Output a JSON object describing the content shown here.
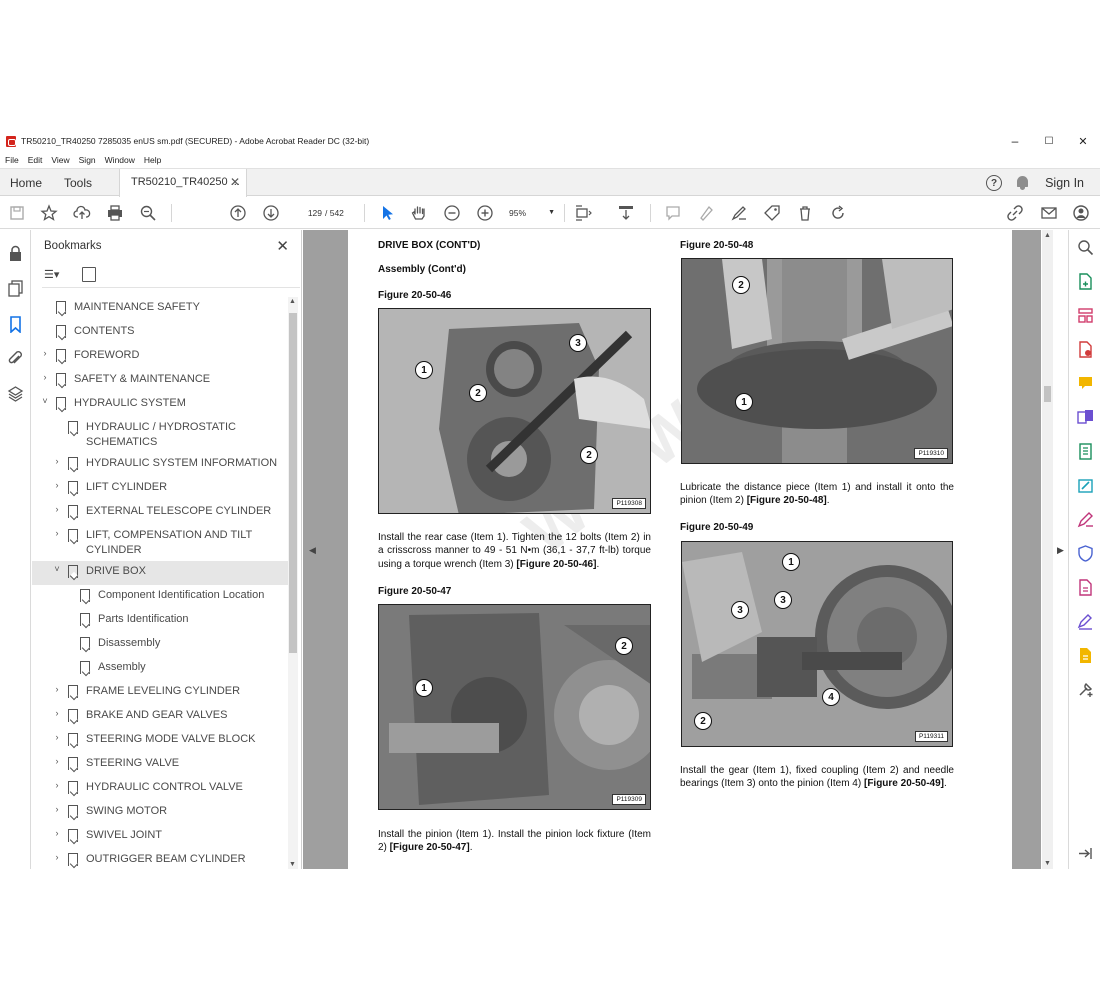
{
  "window": {
    "title": "TR50210_TR40250 7285035 enUS sm.pdf (SECURED) - Adobe Acrobat Reader DC (32-bit)",
    "minimize": "–",
    "maximize": "☐",
    "close": "✕"
  },
  "menu": [
    "File",
    "Edit",
    "View",
    "Sign",
    "Window",
    "Help"
  ],
  "tabs": {
    "home": "Home",
    "tools": "Tools",
    "document": "TR50210_TR40250 ...",
    "document_close": "✕",
    "help": "?",
    "signin": "Sign In"
  },
  "toolbar": {
    "page_current": "129",
    "page_total": "/ 542",
    "zoom": "95%"
  },
  "bookmarks": {
    "title": "Bookmarks",
    "close": "✕",
    "items": [
      {
        "label": "MAINTENANCE SAFETY",
        "level": 0,
        "expand": ""
      },
      {
        "label": "CONTENTS",
        "level": 0,
        "expand": ""
      },
      {
        "label": "FOREWORD",
        "level": 0,
        "expand": "›"
      },
      {
        "label": "SAFETY & MAINTENANCE",
        "level": 0,
        "expand": "›"
      },
      {
        "label": "HYDRAULIC SYSTEM",
        "level": 0,
        "expand": "˅"
      },
      {
        "label": "HYDRAULIC / HYDROSTATIC",
        "label2": "SCHEMATICS",
        "level": 1,
        "expand": ""
      },
      {
        "label": "HYDRAULIC SYSTEM INFORMATION",
        "level": 1,
        "expand": "›"
      },
      {
        "label": "LIFT CYLINDER",
        "level": 1,
        "expand": "›"
      },
      {
        "label": "EXTERNAL TELESCOPE CYLINDER",
        "level": 1,
        "expand": "›"
      },
      {
        "label": "LIFT, COMPENSATION AND TILT",
        "label2": "CYLINDER",
        "level": 1,
        "expand": "›"
      },
      {
        "label": "DRIVE BOX",
        "level": 1,
        "expand": "˅",
        "selected": true
      },
      {
        "label": "Component Identification Location",
        "level": 2,
        "expand": ""
      },
      {
        "label": "Parts Identification",
        "level": 2,
        "expand": ""
      },
      {
        "label": "Disassembly",
        "level": 2,
        "expand": ""
      },
      {
        "label": "Assembly",
        "level": 2,
        "expand": ""
      },
      {
        "label": "FRAME LEVELING CYLINDER",
        "level": 1,
        "expand": "›"
      },
      {
        "label": "BRAKE AND GEAR VALVES",
        "level": 1,
        "expand": "›"
      },
      {
        "label": "STEERING MODE VALVE BLOCK",
        "level": 1,
        "expand": "›"
      },
      {
        "label": "STEERING VALVE",
        "level": 1,
        "expand": "›"
      },
      {
        "label": "HYDRAULIC CONTROL VALVE",
        "level": 1,
        "expand": "›"
      },
      {
        "label": "SWING MOTOR",
        "level": 1,
        "expand": "›"
      },
      {
        "label": "SWIVEL JOINT",
        "level": 1,
        "expand": "›"
      },
      {
        "label": "OUTRIGGER BEAM CYLINDER",
        "level": 1,
        "expand": "›"
      }
    ]
  },
  "document": {
    "heading": "DRIVE BOX (CONT'D)",
    "subheading": "Assembly (Cont'd)",
    "fig46": {
      "title": "Figure 20-50-46",
      "code": "P119308",
      "text_a": "Install the rear case (Item 1). Tighten the 12 bolts (Item 2) in a crisscross manner to 49 - 51 N•m (36,1 - 37,7 ft-lb) torque using a torque wrench (Item 3) ",
      "text_ref": "[Figure 20-50-46]",
      "text_end": "."
    },
    "fig47": {
      "title": "Figure 20-50-47",
      "code": "P119309",
      "text_a": "Install the pinion (Item 1). Install the pinion lock fixture (Item 2) ",
      "text_ref": "[Figure 20-50-47]",
      "text_end": "."
    },
    "fig48": {
      "title": "Figure 20-50-48",
      "code": "P119310",
      "text_a": "Lubricate the distance piece (Item 1) and install it onto the pinion (Item 2) ",
      "text_ref": "[Figure 20-50-48]",
      "text_end": "."
    },
    "fig49": {
      "title": "Figure 20-50-49",
      "code": "P119311",
      "text_a": "Install the gear (Item 1), fixed coupling (Item 2) and needle bearings (Item 3) onto the pinion (Item 4) ",
      "text_ref": "[Figure 20-50-49]",
      "text_end": "."
    },
    "callouts": {
      "c1": "1",
      "c2": "2",
      "c3": "3",
      "c4": "4"
    }
  },
  "colors": {
    "accent": "#d4241c",
    "doc_bg": "#9f9f9f",
    "selected_bookmark": "#e6e6e6"
  }
}
